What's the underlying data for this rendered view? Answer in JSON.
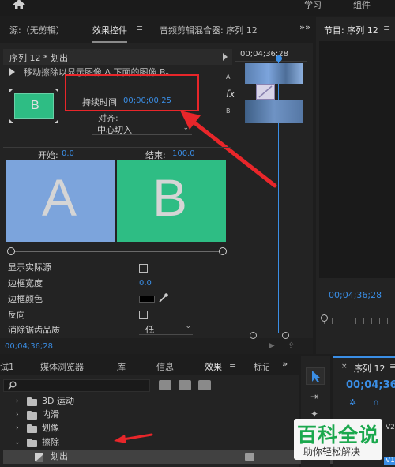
{
  "top_menu": {
    "learn": "学习",
    "components": "组件"
  },
  "source_panel": {
    "tab_source": "源:（无剪辑）",
    "tab_effect_controls": "效果控件",
    "tab_audio_mixer": "音频剪辑混合器: 序列 12",
    "menu_glyph": "≡",
    "overflow_glyph": "»"
  },
  "program_panel": {
    "tab_program": "节目: 序列 12",
    "menu_glyph": "≡",
    "timecode": "00;04;36;28"
  },
  "effect_controls": {
    "clip_path": "序列 12 * 划出",
    "mini_timecode": "00;04;36;28",
    "description": "移动擦除以显示图像 A 下面的图像 B。",
    "duration_label": "持续时间",
    "duration_value": "00;00;00;25",
    "align_label": "对齐:",
    "align_value": "中心切入",
    "start_label": "开始:",
    "start_value": "0.0",
    "end_label": "结束:",
    "end_value": "100.0",
    "preview_a": "A",
    "preview_b": "B",
    "mini_preview_letter": "B",
    "track_a_label": "A",
    "track_b_label": "B",
    "fx_label": "fx",
    "properties": [
      {
        "label": "显示实际源"
      },
      {
        "label": "边框宽度",
        "value": "0.0"
      },
      {
        "label": "边框颜色"
      },
      {
        "label": "反向"
      },
      {
        "label": "消除锯齿品质",
        "value": "低"
      }
    ],
    "footer_timecode": "00;04;36;28",
    "colors": {
      "a_tile": "#7ca4dc",
      "b_tile": "#2ebd84"
    }
  },
  "lower_panel": {
    "tabs": [
      "试1",
      "媒体浏览器",
      "库",
      "信息",
      "效果",
      "标记"
    ],
    "active_tab": "效果",
    "menu_glyph": "≡",
    "overflow_glyph": "»",
    "search_placeholder": "",
    "tree": [
      {
        "label": "3D 运动",
        "expanded": false
      },
      {
        "label": "内滑",
        "expanded": false
      },
      {
        "label": "划像",
        "expanded": false
      },
      {
        "label": "擦除",
        "expanded": true
      },
      {
        "label": "划出",
        "selected": true
      }
    ]
  },
  "timeline_panel": {
    "tab": "序列 12",
    "menu_glyph": "≡",
    "timecode": "00;04;36",
    "track_v2": "V2",
    "track_v1": "V1"
  },
  "watermark": {
    "title": "百科全说",
    "subtitle": "助你轻松解决"
  }
}
